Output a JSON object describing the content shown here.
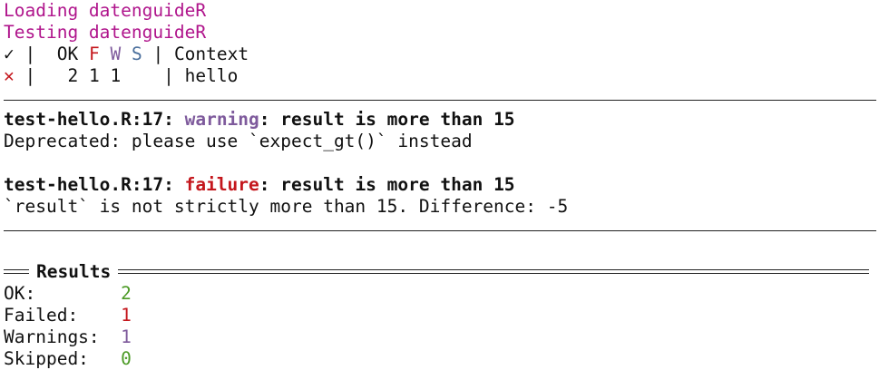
{
  "colors": {
    "magenta": "#b0158c",
    "red": "#c4161c",
    "purple": "#7e5a9c",
    "blue": "#4a6f9c",
    "green": "#4b9a25"
  },
  "status_lines": {
    "loading": "Loading datenguideR",
    "testing": "Testing datenguideR"
  },
  "table": {
    "header": {
      "icon": "✓",
      "icon_name": "check-icon",
      "sep1": " |  ",
      "ok": "OK",
      "f": "F",
      "w": "W",
      "s": "S",
      "sep2": " | ",
      "context": "Context"
    },
    "row": {
      "icon": "✕",
      "icon_name": "cross-icon",
      "sep1": " |   ",
      "ok": "2",
      "f": "1",
      "w": "1",
      "sep2": "    | ",
      "context": "hello"
    }
  },
  "issues": [
    {
      "location": "test-hello.R:17",
      "type": "warning",
      "title": "result is more than 15",
      "message": "Deprecated: please use `expect_gt()` instead"
    },
    {
      "location": "test-hello.R:17",
      "type": "failure",
      "title": "result is more than 15",
      "message": "`result` is not strictly more than 15. Difference: -5"
    }
  ],
  "results": {
    "heading": "Results",
    "ok_label": "OK:",
    "ok_value": "2",
    "failed_label": "Failed:",
    "failed_value": "1",
    "warnings_label": "Warnings:",
    "warnings_value": "1",
    "skipped_label": "Skipped:",
    "skipped_value": "0"
  }
}
